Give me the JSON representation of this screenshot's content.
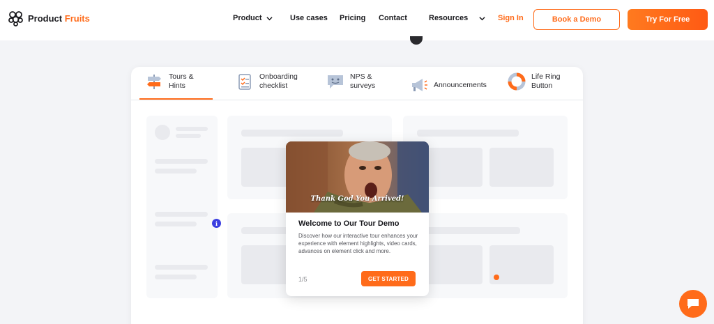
{
  "brand": {
    "name_part1": "Product",
    "name_part2": "Fruits"
  },
  "nav": {
    "product": "Product",
    "use_cases": "Use cases",
    "pricing": "Pricing",
    "contact": "Contact",
    "resources": "Resources",
    "sign_in": "Sign In",
    "book_demo": "Book a Demo",
    "try_free": "Try For Free"
  },
  "tabs": [
    {
      "line1": "Tours &",
      "line2": "Hints",
      "icon": "signpost-icon",
      "active": true
    },
    {
      "line1": "Onboarding",
      "line2": "checklist",
      "icon": "checklist-icon",
      "active": false
    },
    {
      "line1": "NPS &",
      "line2": "surveys",
      "icon": "survey-icon",
      "active": false
    },
    {
      "line1": "Announcements",
      "line2": "",
      "icon": "megaphone-icon",
      "active": false
    },
    {
      "line1": "Life Ring",
      "line2": "Button",
      "icon": "life-ring-icon",
      "active": false
    }
  ],
  "tour": {
    "image_caption": "Thank God You Arrived!",
    "title": "Welcome to Our Tour Demo",
    "body": "Discover how our interactive tour enhances your experience with element highlights, video cards, advances on element click and more.",
    "step": "1/5",
    "cta": "GET STARTED"
  },
  "info_marker": "i",
  "colors": {
    "accent": "#ff6b1a",
    "hotspot": "#3b3fe0"
  }
}
